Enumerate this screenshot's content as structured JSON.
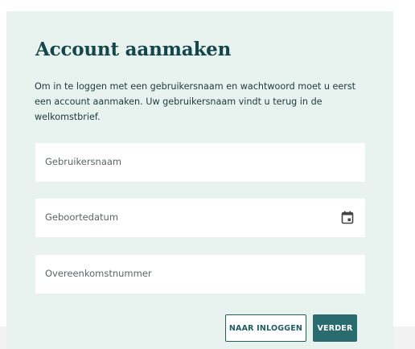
{
  "form": {
    "title": "Account aanmaken",
    "intro": "Om in te loggen met een gebruikersnaam en wachtwoord moet u eerst een account aanmaken. Uw gebruikersnaam vindt u terug in de welkomstbrief.",
    "fields": [
      {
        "placeholder": "Gebruikersnaam",
        "value": ""
      },
      {
        "placeholder": "Geboortedatum",
        "value": "",
        "icon": "calendar-icon"
      },
      {
        "placeholder": "Overeenkomstnummer",
        "value": ""
      }
    ],
    "buttons": {
      "login_label": "NAAR INLOGGEN",
      "next_label": "VERDER"
    }
  },
  "colors": {
    "card_background": "#e8f2ee",
    "title": "#13474b",
    "primary_button": "#2a6b70",
    "secondary_border": "#1f5f63"
  }
}
